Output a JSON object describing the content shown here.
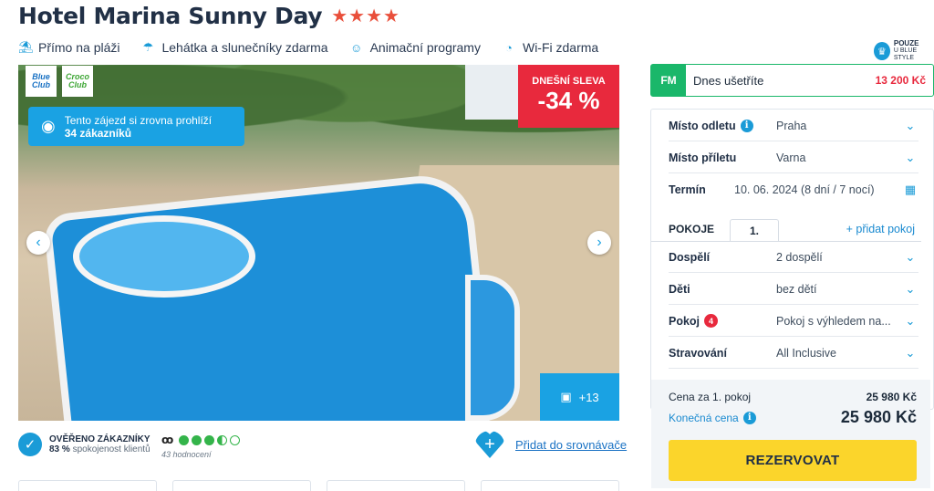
{
  "hotel": {
    "name": "Hotel Marina Sunny Day",
    "stars": "★★★★"
  },
  "amenities": [
    {
      "icon": "beach-icon",
      "label": "Přímo na pláži"
    },
    {
      "icon": "umbrella-icon",
      "label": "Lehátka a slunečníky zdarma"
    },
    {
      "icon": "smile-icon",
      "label": "Animační programy"
    },
    {
      "icon": "wifi-icon",
      "label": "Wi-Fi zdarma"
    }
  ],
  "only_badge": {
    "line1": "POUZE",
    "line2": "U BLUE STYLE"
  },
  "photo": {
    "logo_blue": [
      "Blue",
      "Club"
    ],
    "logo_croco": [
      "Croco",
      "Club"
    ],
    "viewers_line1": "Tento zájezd si zrovna prohlíží",
    "viewers_line2": "34 zákazníků",
    "discount_label": "DNEŠNÍ SLEVA",
    "discount_value": "-34 %",
    "gallery_more": "+13"
  },
  "verified": {
    "title": "OVĚŘENO ZÁKAZNÍKY",
    "percent": "83 %",
    "text": "spokojenost klientů"
  },
  "tripadvisor": {
    "rating": 3.5,
    "reviews": "43 hodnocení"
  },
  "compare": {
    "label": "Přidat do srovnávače"
  },
  "sidebar": {
    "fm_tag": "FM",
    "fm_label": "Dnes ušetříte",
    "fm_amount": "13 200 Kč",
    "departure": {
      "label": "Místo odletu",
      "value": "Praha"
    },
    "arrival": {
      "label": "Místo příletu",
      "value": "Varna"
    },
    "term": {
      "label": "Termín",
      "value": "10. 06. 2024 (8 dní / 7 nocí)"
    },
    "rooms_label": "POKOJE",
    "room_tab": "1.",
    "add_room": "+ přidat pokoj",
    "adults": {
      "label": "Dospělí",
      "value": "2 dospělí"
    },
    "children": {
      "label": "Děti",
      "value": "bez dětí"
    },
    "room": {
      "label": "Pokoj",
      "badge": "4",
      "value": "Pokoj s výhledem na..."
    },
    "board": {
      "label": "Stravování",
      "value": "All Inclusive"
    },
    "price_room_label": "Cena za 1. pokoj",
    "price_room": "25 980 Kč",
    "final_label": "Konečná cena",
    "final_price": "25 980 Kč",
    "reserve": "REZERVOVAT"
  }
}
